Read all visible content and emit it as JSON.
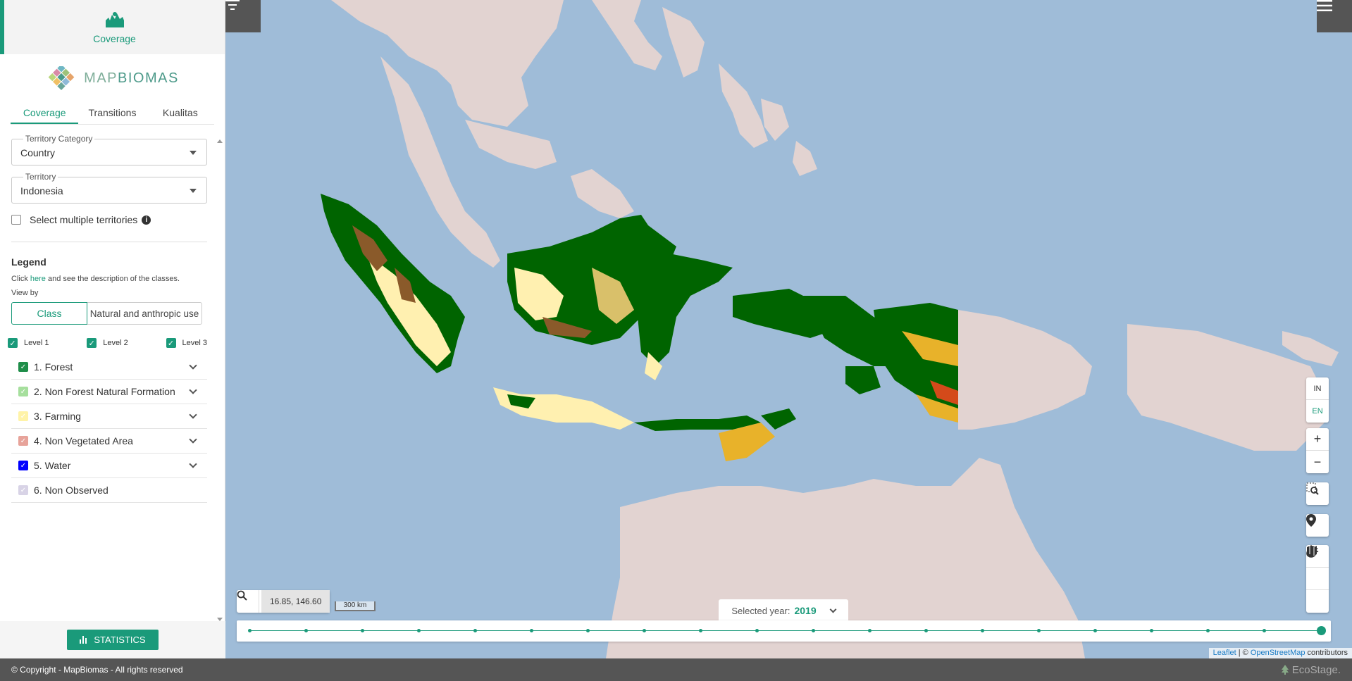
{
  "sidebar": {
    "top_label": "Coverage",
    "logo_text_a": "MAP",
    "logo_text_b": "BIOMAS",
    "tabs": [
      "Coverage",
      "Transitions",
      "Kualitas"
    ],
    "territory_category": {
      "label": "Territory Category",
      "value": "Country"
    },
    "territory": {
      "label": "Territory",
      "value": "Indonesia"
    },
    "multi_select_label": "Select multiple territories",
    "legend": {
      "title": "Legend",
      "desc_prefix": "Click ",
      "desc_link": "here",
      "desc_suffix": " and see the description of the classes.",
      "view_by": "View by",
      "view_options": [
        "Class",
        "Natural and anthropic use"
      ],
      "levels": [
        "Level 1",
        "Level 2",
        "Level 3"
      ],
      "classes": [
        {
          "label": "1. Forest",
          "color": "#1f8d49",
          "checked": true,
          "expandable": true
        },
        {
          "label": "2. Non Forest Natural Formation",
          "color": "#a6df9d",
          "checked": true,
          "expandable": true
        },
        {
          "label": "3. Farming",
          "color": "#fff3a8",
          "checked": true,
          "expandable": true
        },
        {
          "label": "4. Non Vegetated Area",
          "color": "#e7a39a",
          "checked": true,
          "expandable": true
        },
        {
          "label": "5. Water",
          "color": "#0000ff",
          "checked": true,
          "expandable": true
        },
        {
          "label": "6. Non Observed",
          "color": "#d8d3e6",
          "checked": true,
          "expandable": false
        }
      ]
    },
    "statistics_label": "STATISTICS"
  },
  "map": {
    "coords": "16.85, 146.60",
    "scale": "300 km",
    "lang": [
      "IN",
      "EN"
    ],
    "selected_year_label": "Selected year:",
    "selected_year": "2019",
    "attribution_link1": "Leaflet",
    "attribution_sep": " | © ",
    "attribution_link2": "OpenStreetMap",
    "attribution_suffix": " contributors"
  },
  "footer": {
    "copyright": "© Copyright - MapBiomas - All rights reserved",
    "brand": "EcoStage."
  },
  "colors": {
    "accent": "#1a9a7a",
    "forest": "#006400",
    "farming": "#fff3b0",
    "mosaic": "#8a5a2a",
    "savanna": "#e8b22a"
  },
  "icons": [
    "filter-icon",
    "hamburger-menu-icon",
    "search-icon",
    "zoom-in-icon",
    "zoom-out-icon",
    "zoom-area-icon",
    "location-pin-icon",
    "opacity-drop-icon",
    "layers-icon",
    "basemap-icon",
    "bar-chart-icon",
    "info-icon",
    "chevron-down-icon"
  ]
}
